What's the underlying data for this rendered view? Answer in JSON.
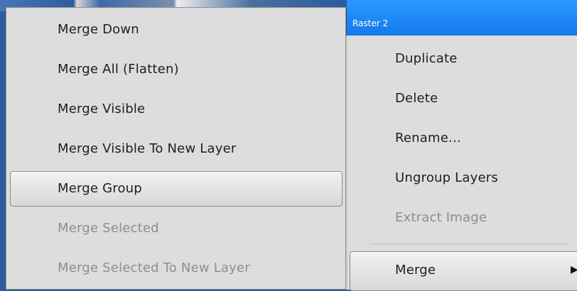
{
  "layer_panel": {
    "selected_layer": "Raster 2"
  },
  "context_menu": {
    "items": [
      {
        "label": "Duplicate",
        "enabled": true
      },
      {
        "label": "Delete",
        "enabled": true
      },
      {
        "label": "Rename...",
        "enabled": true
      },
      {
        "label": "Ungroup Layers",
        "enabled": true
      },
      {
        "label": "Extract Image",
        "enabled": false
      },
      {
        "label": "Merge",
        "enabled": true,
        "highlighted": true,
        "has_submenu": true
      }
    ]
  },
  "merge_submenu": {
    "items": [
      {
        "label": "Merge Down",
        "enabled": true
      },
      {
        "label": "Merge All (Flatten)",
        "enabled": true
      },
      {
        "label": "Merge Visible",
        "enabled": true
      },
      {
        "label": "Merge Visible To New Layer",
        "enabled": true
      },
      {
        "label": "Merge Group",
        "enabled": true,
        "highlighted": true
      },
      {
        "label": "Merge Selected",
        "enabled": false
      },
      {
        "label": "Merge Selected To New Layer",
        "enabled": false
      }
    ]
  },
  "icons": {
    "submenu_arrow": "chevron-right-icon"
  },
  "colors": {
    "header_blue": "#1e86f8",
    "menu_background": "#dddddd",
    "disabled_text": "#8e8e8e"
  }
}
